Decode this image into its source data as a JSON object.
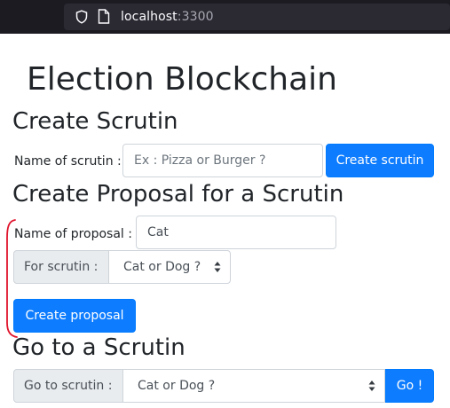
{
  "browser": {
    "url_host": "localhost",
    "url_port": ":3300"
  },
  "app": {
    "title": "Election Blockchain"
  },
  "create_scrutin": {
    "heading": "Create Scrutin",
    "name_label": "Name of scrutin :",
    "name_placeholder": "Ex : Pizza or Burger ?",
    "name_value": "",
    "button_label": "Create scrutin"
  },
  "create_proposal": {
    "heading": "Create Proposal for a Scrutin",
    "name_label": "Name of proposal :",
    "name_value": "Cat",
    "for_scrutin_label": "For scrutin :",
    "for_scrutin_selected": "Cat or Dog ?",
    "button_label": "Create proposal"
  },
  "goto_scrutin": {
    "heading": "Go to a Scrutin",
    "label": "Go to scrutin :",
    "selected": "Cat or Dog ?",
    "button_label": "Go !"
  },
  "colors": {
    "primary": "#0d7cff",
    "annotation": "#e0142c",
    "browser_chrome": "#1c1b22"
  },
  "icons": {
    "shield": "shield-icon",
    "page": "page-icon",
    "select_caret": "select-caret-icon"
  }
}
